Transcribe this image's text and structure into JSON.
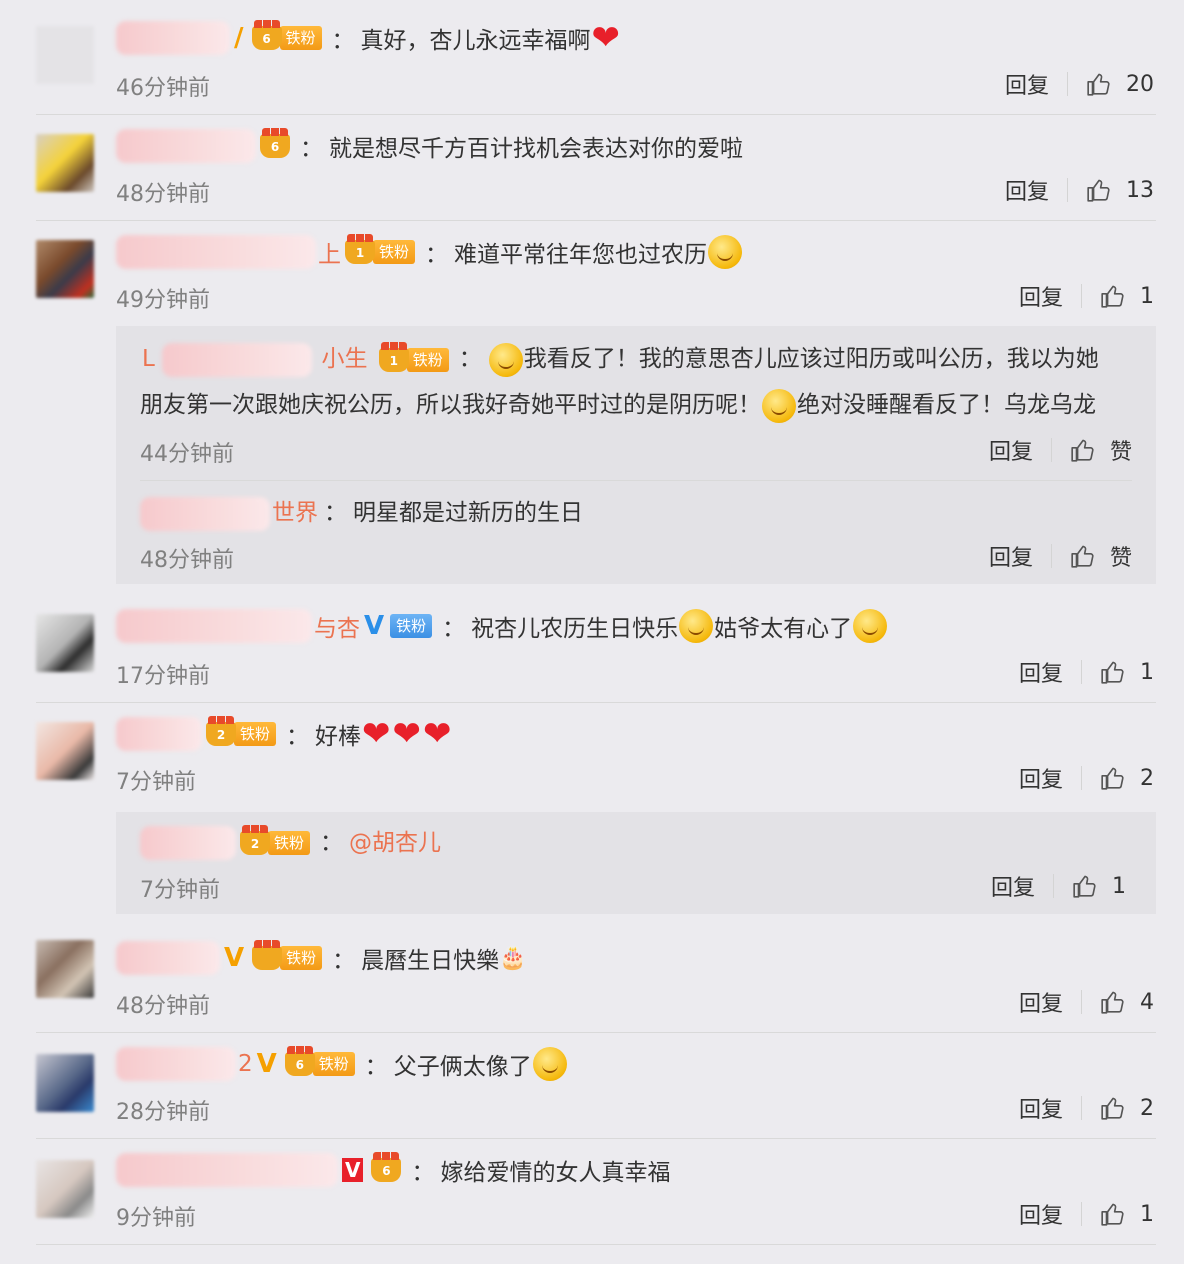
{
  "comments": [
    {
      "name_tail": "",
      "vip": "orange",
      "badge": "6",
      "badge_label": "铁粉",
      "text": "真好，杏儿永远幸福啊",
      "emoji_after": "heart",
      "time": "46分钟前",
      "reply": "回复",
      "likes": "20"
    },
    {
      "name_tail": "",
      "vip": "",
      "badge": "6",
      "badge_label": "",
      "text": "就是想尽千方百计找机会表达对你的爱啦",
      "time": "48分钟前",
      "reply": "回复",
      "likes": "13"
    },
    {
      "name_tail": "上",
      "vip": "",
      "badge": "1",
      "badge_label": "铁粉",
      "text": "难道平常往年您也过农历",
      "emoji_after": "face",
      "time": "49分钟前",
      "reply": "回复",
      "likes": "1"
    },
    {
      "name_tail": "与杏",
      "vip": "blue",
      "badge": "",
      "badge_label": "铁粉",
      "text": "祝杏儿农历生日快乐",
      "text2": "姑爷太有心了",
      "time": "17分钟前",
      "reply": "回复",
      "likes": "1"
    },
    {
      "name_tail": "",
      "vip": "",
      "badge": "2",
      "badge_label": "铁粉",
      "text": "好棒",
      "time": "7分钟前",
      "reply": "回复",
      "likes": "2"
    },
    {
      "name_tail": "",
      "vip": "orange",
      "badge": "",
      "badge_label": "铁粉",
      "text": "晨曆生日快樂",
      "time": "48分钟前",
      "reply": "回复",
      "likes": "4"
    },
    {
      "name_tail": "2",
      "vip": "orange",
      "badge": "6",
      "badge_label": "铁粉",
      "text": "父子俩太像了",
      "time": "28分钟前",
      "reply": "回复",
      "likes": "2"
    },
    {
      "name_tail": "",
      "vip": "orange",
      "badge": "6",
      "badge_label": "",
      "text": "嫁给爱情的女人真幸福",
      "time": "9分钟前",
      "reply": "回复",
      "likes": "1"
    }
  ],
  "replies": [
    {
      "name_tail": "小生",
      "name_head": "L",
      "badge": "1",
      "badge_label": "铁粉",
      "text_a": "我看反了！我的意思杏儿应该过阳历或叫公历，我以为她朋",
      "text_b": "友第一次跟她庆祝公历，所以我好奇她平时过的是阴历呢！",
      "text_c": "绝对没睡醒看反了！乌龙乌龙",
      "time": "44分钟前",
      "reply": "回复",
      "likes": "赞"
    },
    {
      "name_tail": "世界",
      "text": "明星都是过新历的生日",
      "time": "48分钟前",
      "reply": "回复",
      "likes": "赞"
    },
    {
      "name_tail": "",
      "badge": "2",
      "badge_label": "铁粉",
      "mention": "@胡杏儿",
      "time": "7分钟前",
      "reply": "回复",
      "likes": "1"
    }
  ],
  "colors": {
    "background": "#ecebef",
    "sub_background": "#e3e2e6",
    "accent": "#eb7350",
    "vip_orange": "#f5a000",
    "vip_blue": "#2b8fe8",
    "heart": "#e8202a"
  }
}
